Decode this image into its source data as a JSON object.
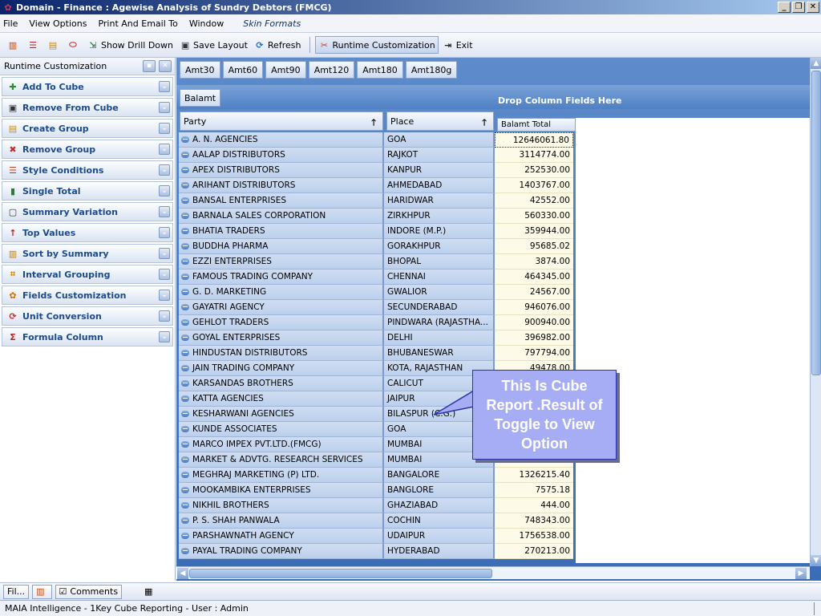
{
  "window": {
    "title": "Domain - Finance : Agewise Analysis of Sundry Debtors (FMCG)",
    "min": "_",
    "restore": "❐",
    "close": "✕"
  },
  "menu": [
    "File",
    "View Options",
    "Print And Email To",
    "Window",
    "Skin Formats"
  ],
  "toolbar": {
    "show_drill_down": "Show Drill Down",
    "save_layout": "Save Layout",
    "refresh": "Refresh",
    "runtime_customization": "Runtime Customization",
    "exit": "Exit"
  },
  "left_panel": {
    "title": "Runtime Customization",
    "items": [
      {
        "label": "Add To Cube",
        "icon": "add-cube-icon",
        "glyph": "✚",
        "color": "#2c8a3a"
      },
      {
        "label": "Remove From Cube",
        "icon": "remove-cube-icon",
        "glyph": "▣",
        "color": "#333333"
      },
      {
        "label": "Create Group",
        "icon": "create-group-icon",
        "glyph": "▤",
        "color": "#d08a00"
      },
      {
        "label": "Remove Group",
        "icon": "remove-group-icon",
        "glyph": "✖",
        "color": "#c03030"
      },
      {
        "label": "Style Conditions",
        "icon": "style-conditions-icon",
        "glyph": "☰",
        "color": "#c04020"
      },
      {
        "label": "Single Total",
        "icon": "single-total-icon",
        "glyph": "▮",
        "color": "#2c7a3a"
      },
      {
        "label": "Summary Variation",
        "icon": "summary-variation-icon",
        "glyph": "▢",
        "color": "#333333"
      },
      {
        "label": "Top Values",
        "icon": "top-values-icon",
        "glyph": "↑",
        "color": "#c02020"
      },
      {
        "label": "Sort by Summary",
        "icon": "sort-summary-icon",
        "glyph": "▥",
        "color": "#c08000"
      },
      {
        "label": "Interval Grouping",
        "icon": "interval-grouping-icon",
        "glyph": "⌗",
        "color": "#d09000"
      },
      {
        "label": "Fields Customization",
        "icon": "fields-customization-icon",
        "glyph": "✿",
        "color": "#d07000"
      },
      {
        "label": "Unit Conversion",
        "icon": "unit-conversion-icon",
        "glyph": "⟳",
        "color": "#c03030"
      },
      {
        "label": "Formula Column",
        "icon": "formula-column-icon",
        "glyph": "Σ",
        "color": "#c02020"
      }
    ]
  },
  "grid": {
    "amt_fields": [
      "Amt30",
      "Amt60",
      "Amt90",
      "Amt120",
      "Amt180",
      "Amt180g"
    ],
    "data_field": "Balamt",
    "drop_column_text": "Drop Column Fields Here",
    "col_party": "Party",
    "col_place": "Place",
    "col_total": "Balamt Total",
    "rows": [
      [
        "A. N. AGENCIES",
        "GOA",
        "12646061.80"
      ],
      [
        "AALAP DISTRIBUTORS",
        "RAJKOT",
        "3114774.00"
      ],
      [
        "APEX DISTRIBUTORS",
        "KANPUR",
        "252530.00"
      ],
      [
        "ARIHANT DISTRIBUTORS",
        "AHMEDABAD",
        "1403767.00"
      ],
      [
        "BANSAL ENTERPRISES",
        "HARIDWAR",
        "42552.00"
      ],
      [
        "BARNALA SALES CORPORATION",
        "ZIRKHPUR",
        "560330.00"
      ],
      [
        "BHATIA TRADERS",
        "INDORE (M.P.)",
        "359944.00"
      ],
      [
        "BUDDHA PHARMA",
        "GORAKHPUR",
        "95685.02"
      ],
      [
        "EZZI ENTERPRISES",
        "BHOPAL",
        "3874.00"
      ],
      [
        "FAMOUS TRADING COMPANY",
        "CHENNAI",
        "464345.00"
      ],
      [
        "G. D. MARKETING",
        "GWALIOR",
        "24567.00"
      ],
      [
        "GAYATRI AGENCY",
        "SECUNDERABAD",
        "946076.00"
      ],
      [
        "GEHLOT TRADERS",
        "PINDWARA (RAJASTHA...",
        "900940.00"
      ],
      [
        "GOYAL ENTERPRISES",
        "DELHI",
        "396982.00"
      ],
      [
        "HINDUSTAN DISTRIBUTORS",
        "BHUBANESWAR",
        "797794.00"
      ],
      [
        "JAIN TRADING COMPANY",
        "KOTA, RAJASTHAN",
        "49478.00"
      ],
      [
        "KARSANDAS BROTHERS",
        "CALICUT",
        ""
      ],
      [
        "KATTA AGENCIES",
        "JAIPUR",
        ""
      ],
      [
        "KESHARWANI AGENCIES",
        "BILASPUR (C.G.)",
        ""
      ],
      [
        "KUNDE ASSOCIATES",
        "GOA",
        ""
      ],
      [
        "MARCO IMPEX PVT.LTD.(FMCG)",
        "MUMBAI",
        ""
      ],
      [
        "MARKET & ADVTG. RESEARCH SERVICES",
        "MUMBAI",
        "158456.00"
      ],
      [
        "MEGHRAJ MARKETING (P) LTD.",
        "BANGALORE",
        "1326215.40"
      ],
      [
        "MOOKAMBIKA ENTERPRISES",
        "BANGLORE",
        "7575.18"
      ],
      [
        "NIKHIL BROTHERS",
        "GHAZIABAD",
        "444.00"
      ],
      [
        "P. S. SHAH PANWALA",
        "COCHIN",
        "748343.00"
      ],
      [
        "PARSHAWNATH AGENCY",
        "UDAIPUR",
        "1756538.00"
      ],
      [
        "PAYAL TRADING COMPANY",
        "HYDERABAD",
        "270213.00"
      ]
    ]
  },
  "callout": "This Is Cube Report .Result of Toggle to View Option",
  "bottom_tabs": {
    "fil": "Fil...",
    "comments": "Comments"
  },
  "status": "MAIA Intelligence - 1Key Cube Reporting - User : Admin"
}
